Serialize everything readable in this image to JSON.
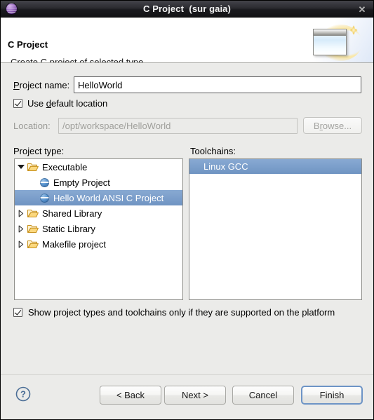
{
  "window": {
    "title": "C Project  (sur gaia)",
    "icon": "eclipse-ball-icon",
    "close_label": "✕"
  },
  "header": {
    "title": "C Project",
    "subtitle": "Create C project of selected type",
    "banner_icon": "wizard-window-sparkle-icon"
  },
  "form": {
    "project_name": {
      "label_pre": "P",
      "label_post": "roject name:",
      "value": "HelloWorld",
      "placeholder": ""
    },
    "use_default_location": {
      "label_pre": "Use ",
      "label_mnemonic": "d",
      "label_post": "efault location",
      "checked": true
    },
    "location": {
      "label": "Location:",
      "value": "/opt/workspace/HelloWorld",
      "enabled": false
    },
    "browse": {
      "label_pre": "B",
      "label_mnemonic": "r",
      "label_post": "owse...",
      "enabled": false
    }
  },
  "project_type": {
    "label": "Project type:",
    "rows": [
      {
        "label": "Executable",
        "level": 1,
        "icon": "open-folder-icon",
        "twisty": "expanded",
        "selected": false
      },
      {
        "label": "Empty Project",
        "level": 2,
        "icon": "blue-sphere-icon",
        "twisty": "none",
        "selected": false
      },
      {
        "label": "Hello World ANSI C Project",
        "level": 2,
        "icon": "blue-sphere-icon",
        "twisty": "none",
        "selected": true
      },
      {
        "label": "Shared Library",
        "level": 1,
        "icon": "open-folder-icon",
        "twisty": "collapsed",
        "selected": false
      },
      {
        "label": "Static Library",
        "level": 1,
        "icon": "open-folder-icon",
        "twisty": "collapsed",
        "selected": false
      },
      {
        "label": "Makefile project",
        "level": 1,
        "icon": "open-folder-icon",
        "twisty": "collapsed",
        "selected": false
      }
    ]
  },
  "toolchains": {
    "label": "Toolchains:",
    "rows": [
      {
        "label": "Linux GCC",
        "selected": true
      }
    ]
  },
  "show_supported": {
    "label": "Show project types and toolchains only if they are supported on the platform",
    "checked": true
  },
  "footer": {
    "help_icon": "help-question-icon",
    "back_label": "< Back",
    "next_label": "Next >",
    "cancel_label": "Cancel",
    "finish_label": "Finish",
    "default_button": "Finish"
  },
  "colors": {
    "selection_blue": "#7c9fcb",
    "titlebar_dark": "#1b1b1f",
    "body_gray": "#ebebe9",
    "focus_border": "#6d94c6"
  }
}
